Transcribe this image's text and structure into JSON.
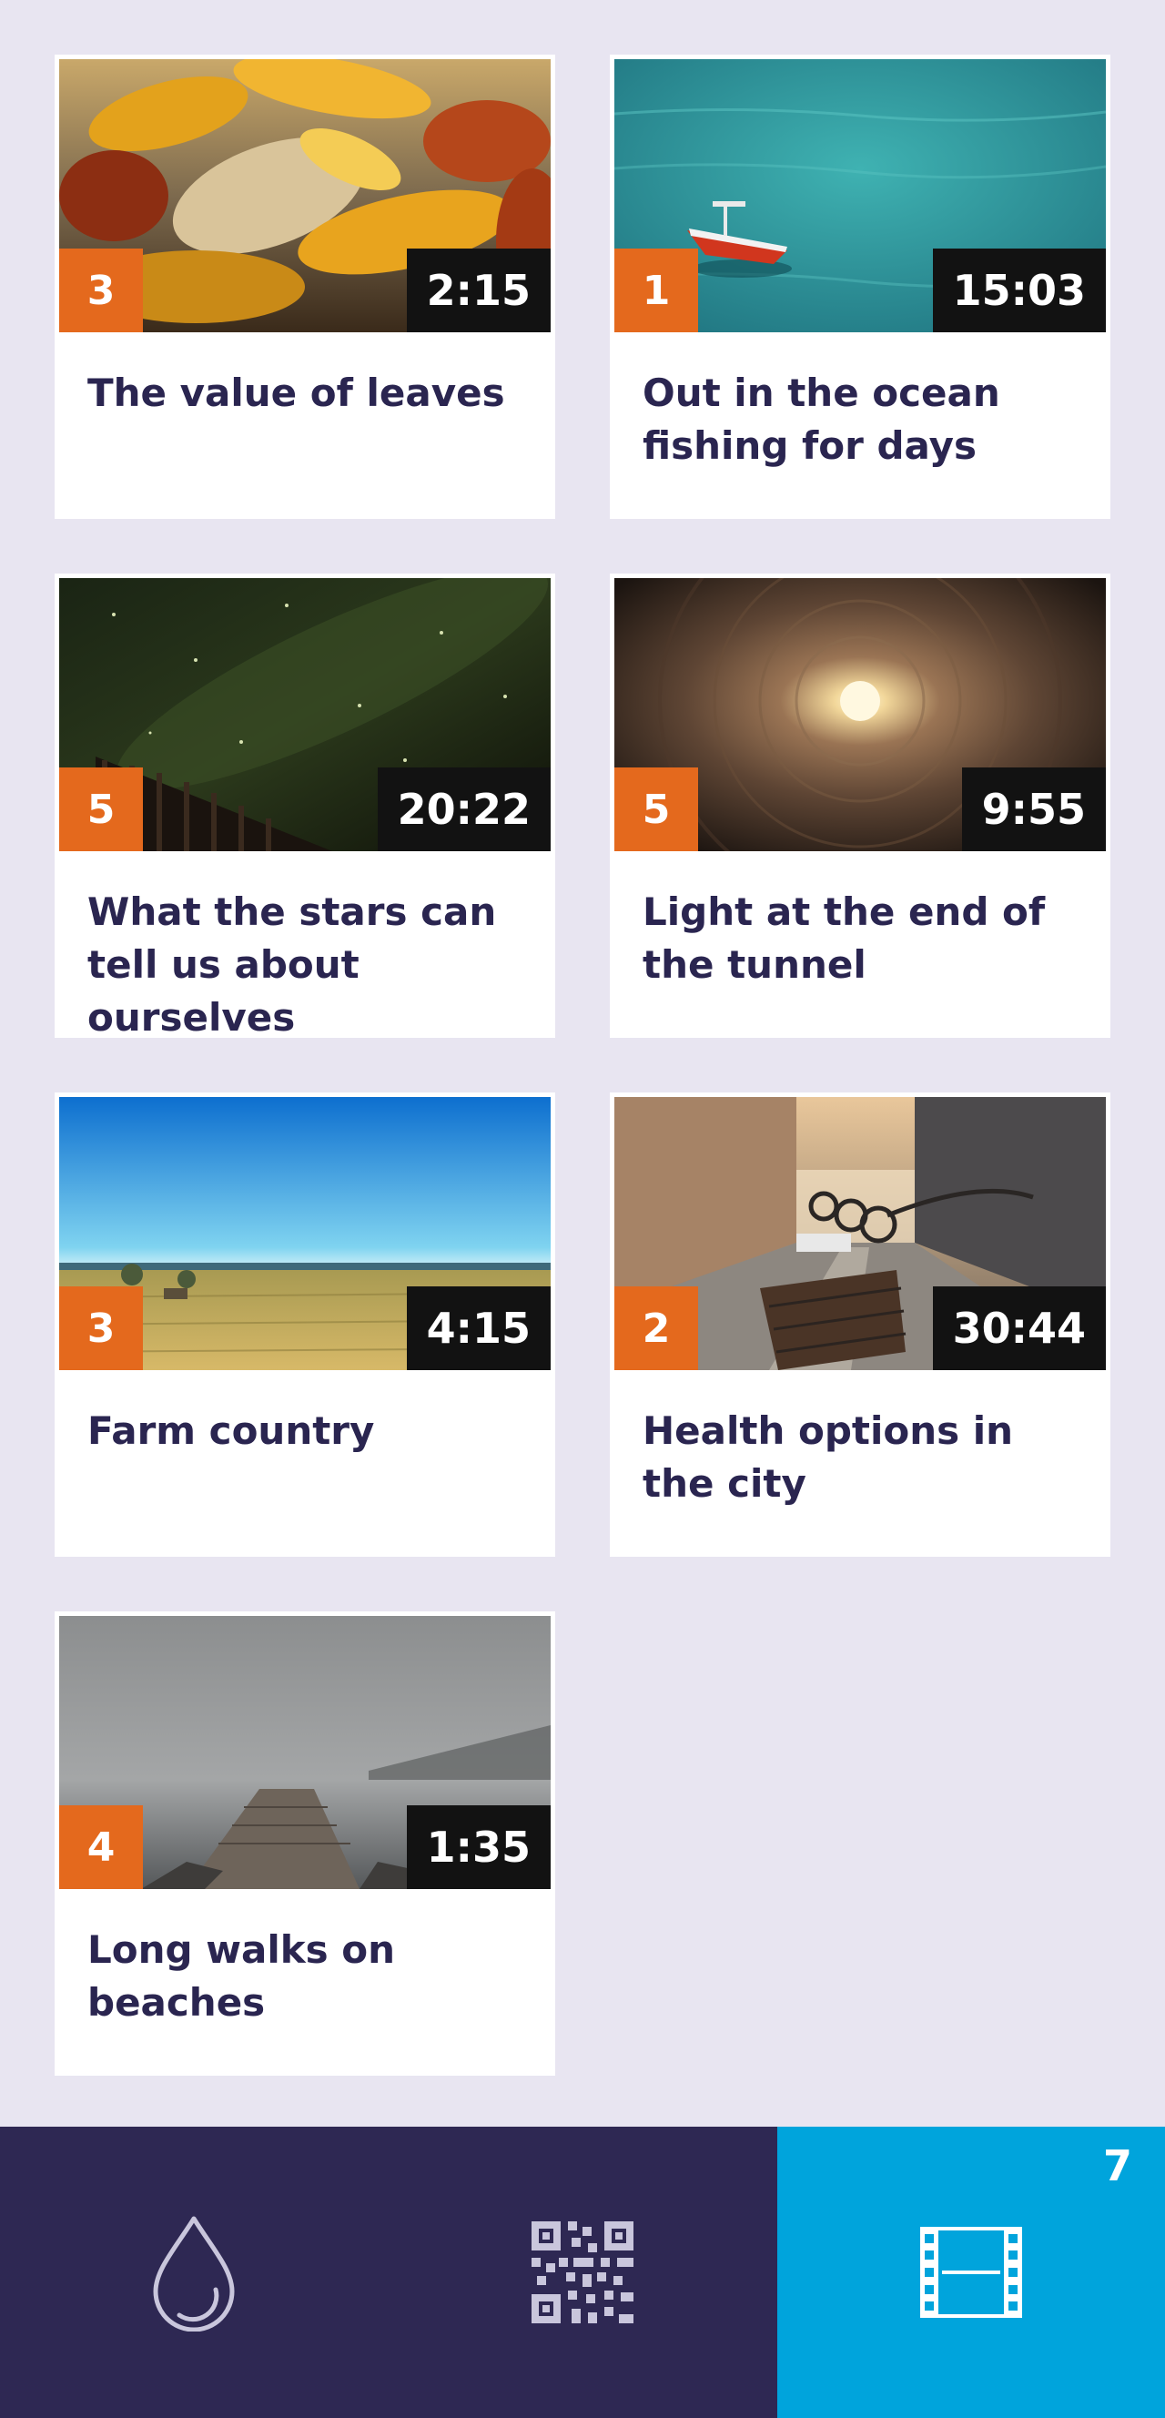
{
  "videos": [
    {
      "title": "The value of leaves",
      "count": "3",
      "duration": "2:15",
      "image": "autumn-leaves"
    },
    {
      "title": "Out in the ocean fishing for days",
      "count": "1",
      "duration": "15:03",
      "image": "boat-on-ocean"
    },
    {
      "title": "What the stars can tell us about ourselves",
      "count": "5",
      "duration": "20:22",
      "image": "night-sky-fence"
    },
    {
      "title": "Light at the end of the tunnel",
      "count": "5",
      "duration": "9:55",
      "image": "tunnel-light"
    },
    {
      "title": "Farm country",
      "count": "3",
      "duration": "4:15",
      "image": "wheat-field"
    },
    {
      "title": "Health options in the city",
      "count": "2",
      "duration": "30:44",
      "image": "city-street-bikes"
    },
    {
      "title": "Long walks on beaches",
      "count": "4",
      "duration": "1:35",
      "image": "foggy-pier"
    }
  ],
  "tabbar": {
    "tabs": [
      {
        "icon": "water-drop-icon",
        "active": false
      },
      {
        "icon": "qr-code-icon",
        "active": false
      },
      {
        "icon": "film-strip-icon",
        "active": true,
        "count": "7"
      }
    ],
    "colors": {
      "bar": "#2e2853",
      "active": "#00a4dc",
      "icon": "#c9c6dc"
    }
  },
  "colors": {
    "background": "#e8e5f1",
    "badge": "#e4691d",
    "duration_bg": "#121212",
    "title": "#2a2550"
  }
}
